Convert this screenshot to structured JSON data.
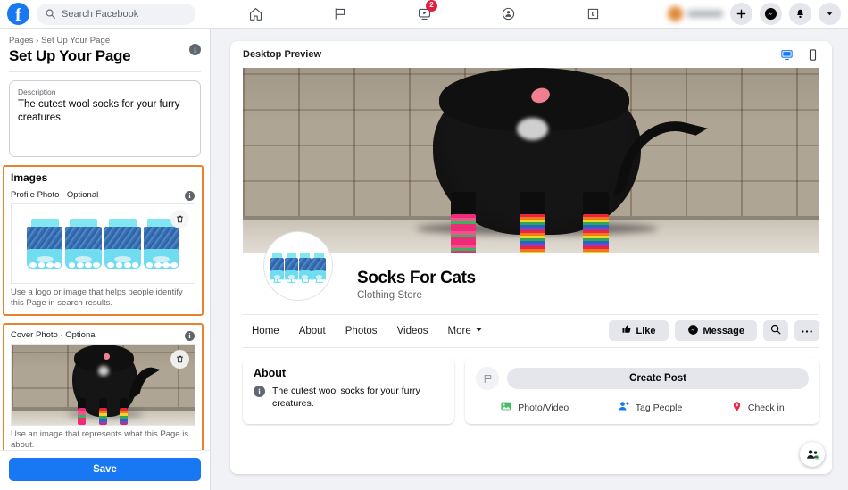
{
  "topbar": {
    "logo_alt": "facebook-logo",
    "search_placeholder": "Search Facebook",
    "nav": [
      {
        "name": "home-icon",
        "label": "Home",
        "badge": ""
      },
      {
        "name": "pages-flag-icon",
        "label": "Pages",
        "badge": ""
      },
      {
        "name": "watch-icon",
        "label": "Watch",
        "badge": "2"
      },
      {
        "name": "groups-icon",
        "label": "Groups",
        "badge": ""
      },
      {
        "name": "gaming-icon",
        "label": "Gaming",
        "badge": ""
      }
    ],
    "right_buttons": [
      {
        "name": "create-button",
        "glyph": "+"
      },
      {
        "name": "messenger-button",
        "glyph": "messenger"
      },
      {
        "name": "notifications-button",
        "glyph": "bell"
      },
      {
        "name": "account-menu-button",
        "glyph": "chevron-down"
      }
    ]
  },
  "left_panel": {
    "breadcrumb": "Pages › Set Up Your Page",
    "title": "Set Up Your Page",
    "info_glyph": "i",
    "description": {
      "label": "Description",
      "value": "The cutest wool socks for your furry creatures."
    },
    "images_section": {
      "title": "Images",
      "profile_photo": {
        "label": "Profile Photo · Optional",
        "hint": "Use a logo or image that helps people identify this Page in search results.",
        "delete_label": "Delete profile photo"
      },
      "cover_photo": {
        "label": "Cover Photo · Optional",
        "hint": "Use an image that represents what this Page is about.",
        "delete_label": "Delete cover photo"
      }
    },
    "save_label": "Save",
    "highlight_color": "#e8822c",
    "primary_color": "#1877f2"
  },
  "preview": {
    "title": "Desktop Preview",
    "toggles": [
      {
        "name": "desktop-preview-toggle",
        "label": "Desktop",
        "active": true,
        "color": "#1877f2"
      },
      {
        "name": "mobile-preview-toggle",
        "label": "Mobile",
        "active": false,
        "color": "#3a3b3c"
      }
    ],
    "page_name": "Socks For Cats",
    "page_category": "Clothing Store",
    "tabs": [
      "Home",
      "About",
      "Photos",
      "Videos"
    ],
    "more_label": "More",
    "actions": [
      {
        "name": "like-button",
        "label": "Like",
        "icon": "thumbs-up-icon"
      },
      {
        "name": "message-button",
        "label": "Message",
        "icon": "messenger-icon"
      },
      {
        "name": "search-page-button",
        "label": "",
        "icon": "search-icon"
      },
      {
        "name": "more-options-button",
        "label": "",
        "icon": "ellipsis-icon"
      }
    ],
    "about_card": {
      "title": "About",
      "text": "The cutest wool socks for your furry creatures."
    },
    "create_post": {
      "placeholder": "Create Post",
      "actions": [
        {
          "name": "photo-video-action",
          "label": "Photo/Video",
          "icon": "photo-icon",
          "color": "#45bd62"
        },
        {
          "name": "tag-people-action",
          "label": "Tag People",
          "icon": "tag-person-icon",
          "color": "#1877f2"
        },
        {
          "name": "check-in-action",
          "label": "Check in",
          "icon": "location-pin-icon",
          "color": "#f02849"
        }
      ]
    }
  },
  "fab": {
    "name": "contacts-fab",
    "label": "Contacts"
  }
}
